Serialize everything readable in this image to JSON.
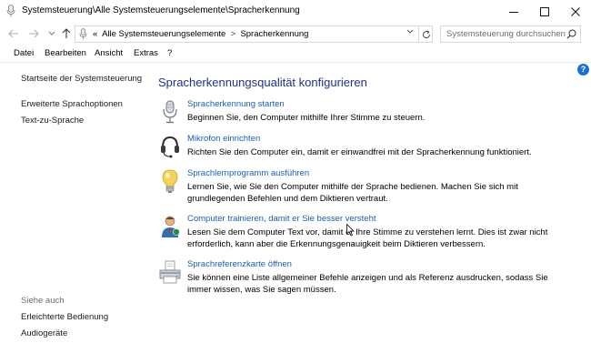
{
  "window": {
    "title": "Systemsteuerung\\Alle Systemsteuerungselemente\\Spracherkennung"
  },
  "address": {
    "chevrons": "«",
    "crumbs": [
      "Alle Systemsteuerungselemente",
      "Spracherkennung"
    ],
    "separator": ">"
  },
  "search": {
    "placeholder": "Systemsteuerung durchsuchen"
  },
  "menu": {
    "items": [
      "Datei",
      "Bearbeiten",
      "Ansicht",
      "Extras",
      "?"
    ]
  },
  "help_label": "?",
  "sidebar": {
    "home": "Startseite der Systemsteuerung",
    "links": [
      "Erweiterte Sprachoptionen",
      "Text-zu-Sprache"
    ],
    "see_also": "Siehe auch",
    "see_also_links": [
      "Erleichterte Bedienung",
      "Audiogeräte"
    ]
  },
  "main": {
    "title": "Spracherkennungsqualität konfigurieren",
    "tasks": [
      {
        "icon": "microphone-icon",
        "link": "Spracherkennung starten",
        "desc": "Beginnen Sie, den Computer mithilfe Ihrer Stimme zu steuern."
      },
      {
        "icon": "headset-icon",
        "link": "Mikrofon einrichten",
        "desc": "Richten Sie den Computer ein, damit er einwandfrei mit der Spracherkennung funktioniert."
      },
      {
        "icon": "lightbulb-icon",
        "link": "Sprachlernprogramm ausführen",
        "desc": "Lernen Sie, wie Sie den Computer mithilfe der Sprache bedienen. Machen Sie sich mit grundlegenden Befehlen und dem Diktieren vertraut."
      },
      {
        "icon": "user-train-icon",
        "link": "Computer trainieren, damit er Sie besser versteht",
        "desc": "Lesen Sie dem Computer Text vor, damit er Ihre Stimme zu verstehen lernt. Dies ist zwar nicht erforderlich, kann aber die Erkennungsgenauigkeit beim Diktieren verbessern."
      },
      {
        "icon": "printer-icon",
        "link": "Sprachreferenzkarte öffnen",
        "desc": "Sie können eine Liste allgemeiner Befehle anzeigen und als Referenz ausdrucken, sodass Sie immer wissen, was Sie sagen müssen."
      }
    ]
  },
  "colors": {
    "link": "#1a5fb4",
    "title": "#1e3287",
    "help": "#1f6fd1"
  }
}
